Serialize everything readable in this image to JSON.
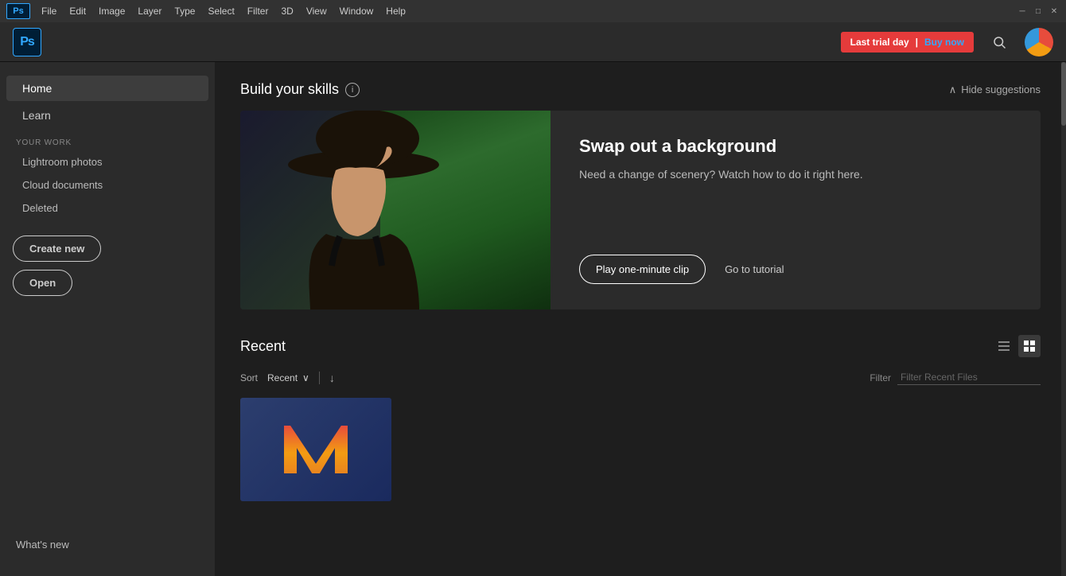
{
  "titlebar": {
    "menu_items": [
      "File",
      "Edit",
      "Image",
      "Layer",
      "Type",
      "Select",
      "Filter",
      "3D",
      "View",
      "Window",
      "Help"
    ],
    "win_buttons": [
      "minimize",
      "maximize",
      "close"
    ],
    "win_minimize": "─",
    "win_maximize": "□",
    "win_close": "✕"
  },
  "toolbar": {
    "ps_label": "Ps",
    "trial_text": "Last trial day",
    "separator": "|",
    "buy_text": "Buy now",
    "search_icon": "🔍"
  },
  "sidebar": {
    "nav": {
      "home_label": "Home",
      "learn_label": "Learn"
    },
    "your_work_label": "YOUR WORK",
    "work_items": [
      "Lightroom photos",
      "Cloud documents",
      "Deleted"
    ],
    "create_label": "Create new",
    "open_label": "Open",
    "whats_new_label": "What's new"
  },
  "skills": {
    "title": "Build your skills",
    "info_icon": "i",
    "hide_label": "Hide suggestions",
    "chevron_up": "∧",
    "feature": {
      "heading": "Swap out a background",
      "description": "Need a change of scenery? Watch how to do it right here.",
      "play_label": "Play one-minute clip",
      "tutorial_label": "Go to tutorial"
    }
  },
  "recent": {
    "title": "Recent",
    "list_icon": "≡",
    "grid_icon": "⊞",
    "sort_label": "Sort",
    "sort_value": "Recent",
    "sort_chevron": "∨",
    "sort_dir_icon": "↓",
    "filter_label": "Filter",
    "filter_placeholder": "Filter Recent Files",
    "files": [
      {
        "name": "monkeytype_logo",
        "bg_color": "#2c3e6e"
      }
    ]
  },
  "colors": {
    "accent": "#31a8ff",
    "trial_red": "#e53b3b",
    "bg_dark": "#1e1e1e",
    "bg_medium": "#2b2b2b",
    "sidebar_bg": "#2b2b2b",
    "text_primary": "#ffffff",
    "text_secondary": "#cccccc",
    "text_muted": "#888888"
  }
}
